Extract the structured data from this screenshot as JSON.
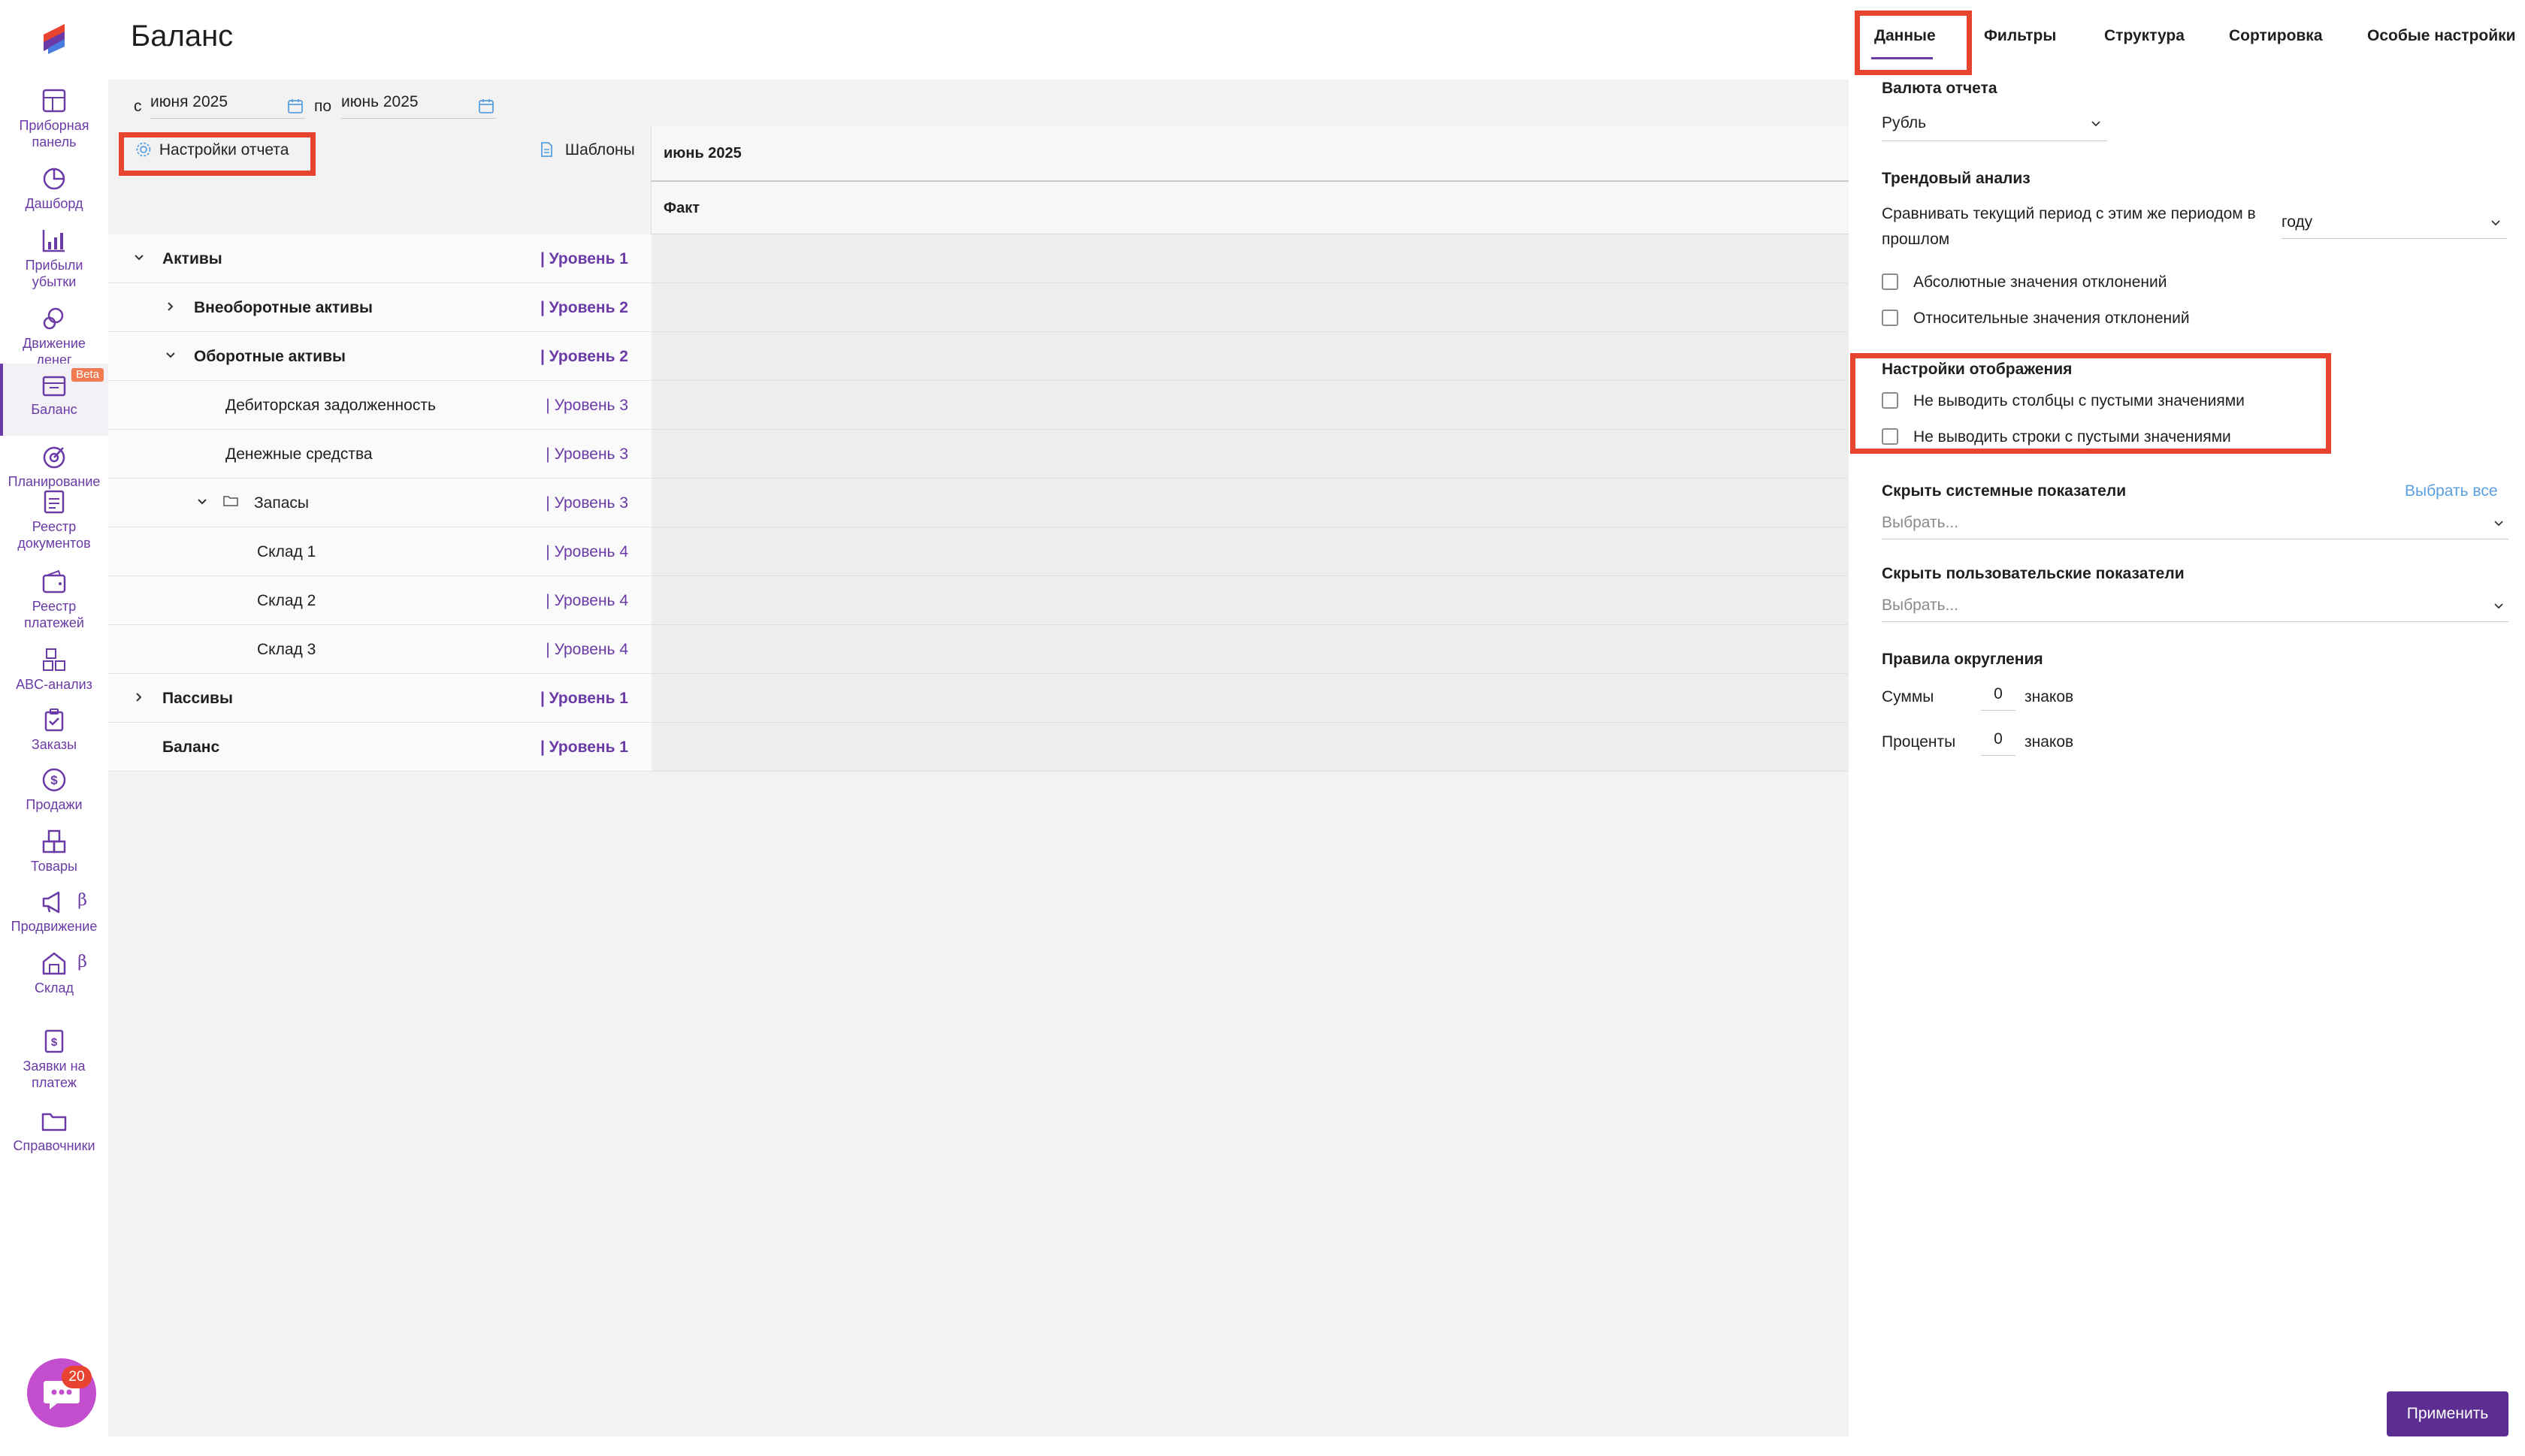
{
  "app": {
    "page_title": "Баланс"
  },
  "sidebar": {
    "items": [
      {
        "label": "Приборная панель",
        "icon": "dashboard-panel-icon"
      },
      {
        "label": "Дашборд",
        "icon": "pie-chart-icon"
      },
      {
        "label": "Прибыли убытки",
        "icon": "bar-chart-icon"
      },
      {
        "label": "Движение денег",
        "icon": "money-flow-icon"
      },
      {
        "label": "Баланс",
        "icon": "balance-icon",
        "badge": "Beta",
        "active": true
      },
      {
        "label": "Планирование",
        "icon": "target-icon"
      },
      {
        "label": "Реестр документов",
        "icon": "documents-icon"
      },
      {
        "label": "Реестр платежей",
        "icon": "wallet-icon"
      },
      {
        "label": "ABC-анализ",
        "icon": "abc-icon"
      },
      {
        "label": "Заказы",
        "icon": "orders-icon"
      },
      {
        "label": "Продажи",
        "icon": "dollar-icon"
      },
      {
        "label": "Товары",
        "icon": "boxes-icon"
      },
      {
        "label": "Продвижение",
        "icon": "megaphone-icon",
        "beta_symbol": "β"
      },
      {
        "label": "Склад",
        "icon": "warehouse-icon",
        "beta_symbol": "β"
      },
      {
        "label": "Заявки на платеж",
        "icon": "payment-request-icon"
      },
      {
        "label": "Справочники",
        "icon": "folder-icon"
      }
    ],
    "chat_count": "20"
  },
  "filters": {
    "from_label": "с",
    "from_value": "июня 2025",
    "to_label": "по",
    "to_value": "июнь 2025"
  },
  "toolbar": {
    "settings_label": "Настройки отчета",
    "templates_label": "Шаблоны"
  },
  "table": {
    "period_header": "июнь 2025",
    "fact_header": "Факт",
    "rows": [
      {
        "label": "Активы",
        "level": "| Уровень 1"
      },
      {
        "label": "Внеоборотные активы",
        "level": "| Уровень 2"
      },
      {
        "label": "Оборотные активы",
        "level": "| Уровень 2"
      },
      {
        "label": "Дебиторская задолженность",
        "level": "| Уровень 3"
      },
      {
        "label": "Денежные средства",
        "level": "| Уровень 3"
      },
      {
        "label": "Запасы",
        "level": "| Уровень 3"
      },
      {
        "label": "Склад 1",
        "level": "| Уровень 4"
      },
      {
        "label": "Склад 2",
        "level": "| Уровень 4"
      },
      {
        "label": "Склад 3",
        "level": "| Уровень 4"
      },
      {
        "label": "Пассивы",
        "level": "| Уровень 1"
      },
      {
        "label": "Баланс",
        "level": "| Уровень 1"
      }
    ]
  },
  "panel": {
    "tabs": [
      "Данные",
      "Фильтры",
      "Структура",
      "Сортировка",
      "Особые настройки"
    ],
    "currency_label": "Валюта отчета",
    "currency_value": "Рубль",
    "trend_label": "Трендовый анализ",
    "trend_compare_text": "Сравнивать текущий период с этим же периодом в прошлом",
    "trend_period_value": "году",
    "abs_deviation": "Абсолютные значения отклонений",
    "rel_deviation": "Относительные значения отклонений",
    "display_label": "Настройки отображения",
    "hide_empty_cols": "Не выводить столбцы с пустыми значениями",
    "hide_empty_rows": "Не выводить строки с пустыми значениями",
    "hide_system_label": "Скрыть системные показатели",
    "select_all": "Выбрать все",
    "select_placeholder": "Выбрать...",
    "hide_user_label": "Скрыть пользовательские показатели",
    "rounding_label": "Правила округления",
    "sums_label": "Суммы",
    "sums_value": "0",
    "percents_label": "Проценты",
    "percents_value": "0",
    "signs_label": "знаков",
    "apply_label": "Применить"
  },
  "colors": {
    "accent": "#6a3aa6",
    "highlight": "#e8432e",
    "apply_button": "#5c2e91",
    "link": "#5aa0e0"
  }
}
